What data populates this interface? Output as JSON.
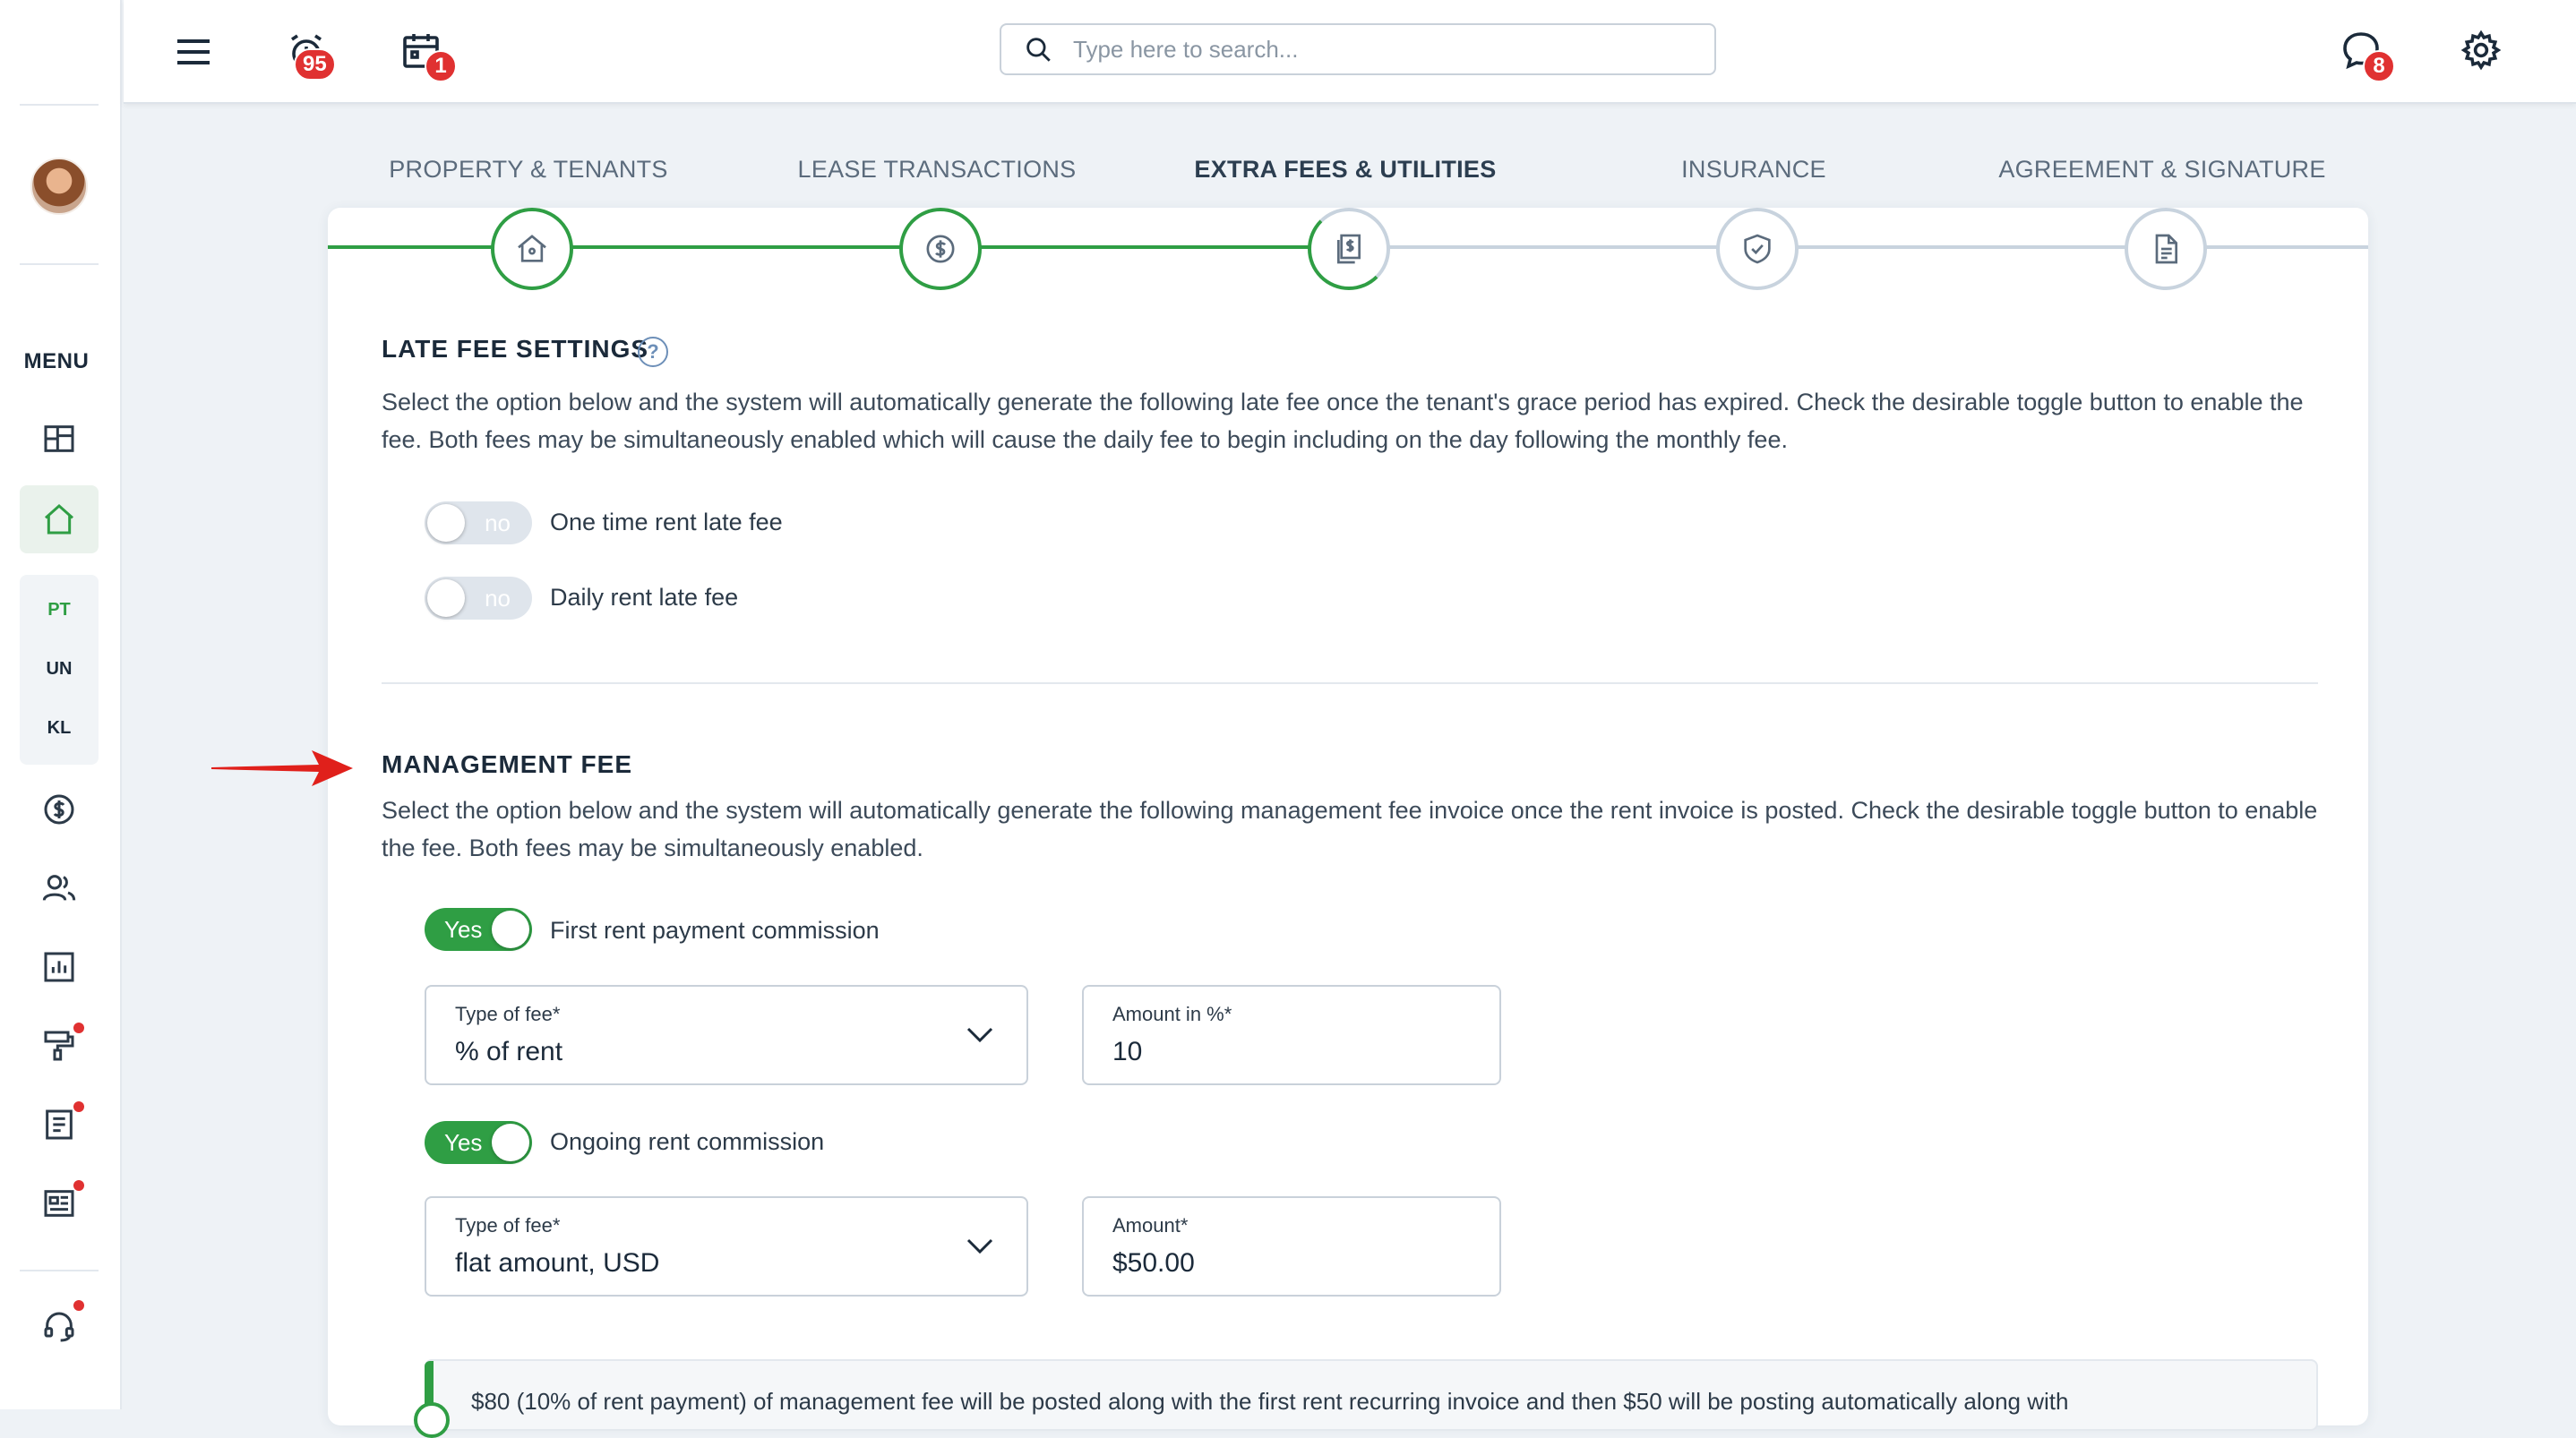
{
  "topbar": {
    "notifications_badge": "95",
    "calendar_badge": "1",
    "messages_badge": "8",
    "search_placeholder": "Type here to search..."
  },
  "sidebar": {
    "menu_label": "MENU",
    "abbreviations": [
      "PT",
      "UN",
      "KL"
    ]
  },
  "stepper": {
    "steps": [
      {
        "label": "PROPERTY & TENANTS",
        "state": "completed",
        "icon": "house-icon"
      },
      {
        "label": "LEASE TRANSACTIONS",
        "state": "completed",
        "icon": "dollar-circle-icon"
      },
      {
        "label": "EXTRA FEES & UTILITIES",
        "state": "active",
        "icon": "documents-dollar-icon"
      },
      {
        "label": "INSURANCE",
        "state": "pending",
        "icon": "shield-check-icon"
      },
      {
        "label": "AGREEMENT & SIGNATURE",
        "state": "pending",
        "icon": "document-icon"
      }
    ]
  },
  "late_fee": {
    "title": "LATE FEE SETTINGS",
    "help": "?",
    "description": "Select the option below and the system will automatically generate the following late fee once the tenant's grace period has expired. Check the desirable toggle button to enable the fee. Both fees may be simultaneously enabled which will cause the daily fee to begin including on the day following the monthly fee.",
    "toggles": [
      {
        "state": "no",
        "label": "One time rent late fee"
      },
      {
        "state": "no",
        "label": "Daily rent late fee"
      }
    ]
  },
  "management_fee": {
    "title": "MANAGEMENT FEE",
    "description": "Select the option below and the system will automatically generate the following management fee invoice once the rent invoice is posted. Check the desirable toggle button to enable the fee. Both fees may be simultaneously enabled.",
    "first": {
      "toggle_state": "Yes",
      "toggle_label": "First rent payment commission",
      "type_label": "Type of fee*",
      "type_value": "% of rent",
      "amount_label": "Amount in %*",
      "amount_value": "10"
    },
    "ongoing": {
      "toggle_state": "Yes",
      "toggle_label": "Ongoing rent commission",
      "type_label": "Type of fee*",
      "type_value": "flat amount, USD",
      "amount_label": "Amount*",
      "amount_value": "$50.00"
    },
    "info_text": "$80 (10% of rent payment) of management fee will be posted along with the first rent recurring invoice and then $50 will be posting automatically along with"
  },
  "colors": {
    "accent_green": "#2f9e44",
    "badge_red": "#e03131",
    "arrow_red": "#e0201b"
  }
}
